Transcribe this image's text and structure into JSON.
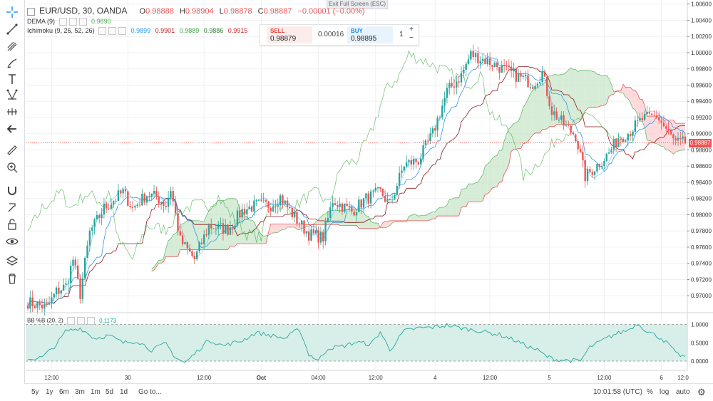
{
  "window": {
    "exit_fullscreen_label": "Exit Full Screen (ESC)"
  },
  "header": {
    "symbol": "EUR/USD, 30, OANDA",
    "open_label": "O",
    "open": "0.98888",
    "high_label": "H",
    "high": "0.98904",
    "low_label": "L",
    "low": "0.98878",
    "close_label": "C",
    "close": "0.98887",
    "change": "−0.00001 (−0.00%)"
  },
  "indicators": {
    "dema": {
      "label": "DEMA (9)",
      "value": "0.9890"
    },
    "ichimoku": {
      "label": "Ichimoku (9, 26, 52, 26)",
      "values": [
        "0.9899",
        "0.9901",
        "0.9889",
        "0.9886",
        "0.9915"
      ]
    },
    "bb_percent": {
      "label": "BB %B (20, 2)",
      "value": "0.1173"
    }
  },
  "trade_panel": {
    "sell_label": "SELL",
    "sell_price": "0.98879",
    "spread": "0.00016",
    "buy_label": "BUY",
    "buy_price": "0.98895",
    "quantity": "1",
    "plus": "+",
    "minus": "−"
  },
  "price_axis": {
    "ticks": [
      "1.00600",
      "1.00400",
      "1.00200",
      "1.00000",
      "0.99800",
      "0.99600",
      "0.99400",
      "0.99200",
      "0.99000",
      "0.98800",
      "0.98600",
      "0.98400",
      "0.98200",
      "0.98000",
      "0.97800",
      "0.97600",
      "0.97400",
      "0.97200",
      "0.97000"
    ],
    "current_price_tag": "0.98887"
  },
  "oscillator_axis": {
    "ticks": [
      "1.0000",
      "0.5000",
      "0.0000"
    ]
  },
  "time_axis": {
    "labels": [
      "12:00",
      "30",
      "12:00",
      "Oct",
      "04:00",
      "12:00",
      "4",
      "12:00",
      "5",
      "12:00",
      "6",
      "12:0"
    ]
  },
  "bottom_bar": {
    "ranges": [
      "5y",
      "1y",
      "6m",
      "3m",
      "1m",
      "5d",
      "1d"
    ],
    "goto": "Go to...",
    "clock": "10:01:58 (UTC)",
    "percent": "%",
    "log": "log",
    "auto": "auto"
  },
  "toolbar": {
    "icons": [
      "crosshair-icon",
      "trend-line-icon",
      "pitchfork-icon",
      "brush-icon",
      "text-icon",
      "pattern-icon",
      "prediction-icon",
      "back-arrow-icon",
      "ruler-icon",
      "zoom-icon",
      "magnet-icon",
      "lock-drawings-icon",
      "lock-icon",
      "eye-icon",
      "layers-icon",
      "trash-icon"
    ]
  },
  "colors": {
    "up": "#26a69a",
    "down": "#ef5350",
    "kumo_bull": "#c8e6c9",
    "kumo_bear": "#ffcdd2",
    "bb_fill": "#d8efe9",
    "dema": "#2196f3",
    "lagging": "#4caf50",
    "base_line": "#8e1b1b"
  },
  "chart_data": {
    "type": "candlestick",
    "interval": "30m",
    "ylim": [
      0.968,
      1.0065
    ],
    "price_keypoints": [
      {
        "t": 0,
        "p": 0.9692
      },
      {
        "t": 4,
        "p": 0.9689
      },
      {
        "t": 8,
        "p": 0.9685
      },
      {
        "t": 12,
        "p": 0.9705
      },
      {
        "t": 16,
        "p": 0.9712
      },
      {
        "t": 19,
        "p": 0.9745
      },
      {
        "t": 22,
        "p": 0.9702
      },
      {
        "t": 26,
        "p": 0.9778
      },
      {
        "t": 32,
        "p": 0.9808
      },
      {
        "t": 40,
        "p": 0.9828
      },
      {
        "t": 44,
        "p": 0.9808
      },
      {
        "t": 50,
        "p": 0.9825
      },
      {
        "t": 54,
        "p": 0.9822
      },
      {
        "t": 58,
        "p": 0.9812
      },
      {
        "t": 60,
        "p": 0.9832
      },
      {
        "t": 64,
        "p": 0.9768
      },
      {
        "t": 70,
        "p": 0.9745
      },
      {
        "t": 76,
        "p": 0.9786
      },
      {
        "t": 84,
        "p": 0.9782
      },
      {
        "t": 90,
        "p": 0.9805
      },
      {
        "t": 96,
        "p": 0.9812
      },
      {
        "t": 102,
        "p": 0.9812
      },
      {
        "t": 106,
        "p": 0.9822
      },
      {
        "t": 112,
        "p": 0.9797
      },
      {
        "t": 118,
        "p": 0.9776
      },
      {
        "t": 124,
        "p": 0.9772
      },
      {
        "t": 128,
        "p": 0.9818
      },
      {
        "t": 136,
        "p": 0.9804
      },
      {
        "t": 142,
        "p": 0.982
      },
      {
        "t": 148,
        "p": 0.9828
      },
      {
        "t": 152,
        "p": 0.9812
      },
      {
        "t": 158,
        "p": 0.9862
      },
      {
        "t": 164,
        "p": 0.9867
      },
      {
        "t": 170,
        "p": 0.99
      },
      {
        "t": 176,
        "p": 0.9952
      },
      {
        "t": 182,
        "p": 0.9972
      },
      {
        "t": 186,
        "p": 0.9998
      },
      {
        "t": 194,
        "p": 0.9988
      },
      {
        "t": 204,
        "p": 0.9973
      },
      {
        "t": 212,
        "p": 0.9962
      },
      {
        "t": 216,
        "p": 0.9975
      },
      {
        "t": 220,
        "p": 0.9928
      },
      {
        "t": 226,
        "p": 0.9908
      },
      {
        "t": 230,
        "p": 0.9898
      },
      {
        "t": 234,
        "p": 0.9847
      },
      {
        "t": 238,
        "p": 0.9858
      },
      {
        "t": 244,
        "p": 0.9876
      },
      {
        "t": 248,
        "p": 0.9895
      },
      {
        "t": 252,
        "p": 0.9901
      },
      {
        "t": 258,
        "p": 0.9918
      },
      {
        "t": 264,
        "p": 0.9922
      },
      {
        "t": 268,
        "p": 0.9905
      },
      {
        "t": 272,
        "p": 0.9888
      },
      {
        "t": 276,
        "p": 0.9889
      }
    ],
    "oscillator_keypoints": [
      {
        "t": 0,
        "v": 0.05
      },
      {
        "t": 6,
        "v": 0.1
      },
      {
        "t": 12,
        "v": 0.45
      },
      {
        "t": 16,
        "v": 0.82
      },
      {
        "t": 22,
        "v": 0.9
      },
      {
        "t": 28,
        "v": 0.62
      },
      {
        "t": 34,
        "v": 0.7
      },
      {
        "t": 40,
        "v": 0.5
      },
      {
        "t": 46,
        "v": 0.55
      },
      {
        "t": 52,
        "v": 0.3
      },
      {
        "t": 58,
        "v": 0.48
      },
      {
        "t": 62,
        "v": 0.1
      },
      {
        "t": 66,
        "v": -0.05
      },
      {
        "t": 70,
        "v": 0.2
      },
      {
        "t": 76,
        "v": 0.58
      },
      {
        "t": 82,
        "v": 0.42
      },
      {
        "t": 90,
        "v": 0.56
      },
      {
        "t": 96,
        "v": 0.78
      },
      {
        "t": 102,
        "v": 0.7
      },
      {
        "t": 108,
        "v": 0.62
      },
      {
        "t": 114,
        "v": 0.88
      },
      {
        "t": 118,
        "v": 0.18
      },
      {
        "t": 122,
        "v": 0.02
      },
      {
        "t": 126,
        "v": 0.35
      },
      {
        "t": 132,
        "v": 0.4
      },
      {
        "t": 138,
        "v": 0.52
      },
      {
        "t": 144,
        "v": 0.45
      },
      {
        "t": 148,
        "v": 0.8
      },
      {
        "t": 152,
        "v": 0.3
      },
      {
        "t": 158,
        "v": 0.82
      },
      {
        "t": 164,
        "v": 0.9
      },
      {
        "t": 170,
        "v": 0.92
      },
      {
        "t": 176,
        "v": 0.98
      },
      {
        "t": 182,
        "v": 0.9
      },
      {
        "t": 190,
        "v": 0.82
      },
      {
        "t": 198,
        "v": 0.72
      },
      {
        "t": 204,
        "v": 0.58
      },
      {
        "t": 210,
        "v": 0.4
      },
      {
        "t": 214,
        "v": 0.3
      },
      {
        "t": 218,
        "v": 0.12
      },
      {
        "t": 222,
        "v": 0.04
      },
      {
        "t": 228,
        "v": 0.02
      },
      {
        "t": 232,
        "v": 0.0
      },
      {
        "t": 236,
        "v": 0.38
      },
      {
        "t": 240,
        "v": 0.52
      },
      {
        "t": 246,
        "v": 0.72
      },
      {
        "t": 252,
        "v": 0.85
      },
      {
        "t": 256,
        "v": 1.02
      },
      {
        "t": 260,
        "v": 0.82
      },
      {
        "t": 266,
        "v": 0.62
      },
      {
        "t": 270,
        "v": 0.4
      },
      {
        "t": 272,
        "v": 0.2
      },
      {
        "t": 276,
        "v": 0.12
      }
    ]
  }
}
